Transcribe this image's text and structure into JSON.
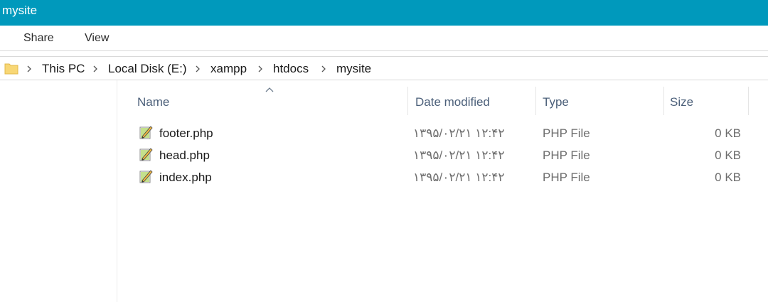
{
  "window": {
    "title": "mysite"
  },
  "ribbon": {
    "tabs": [
      "Share",
      "View"
    ]
  },
  "address": {
    "crumbs": [
      "This PC",
      "Local Disk (E:)",
      "xampp",
      "htdocs",
      "mysite"
    ]
  },
  "columns": {
    "name": "Name",
    "date": "Date modified",
    "type": "Type",
    "size": "Size"
  },
  "files": [
    {
      "name": "footer.php",
      "date": "۱۳۹۵/۰۲/۲۱ ۱۲:۴۲",
      "type": "PHP File",
      "size": "0 KB",
      "icon": "php-file-icon"
    },
    {
      "name": "head.php",
      "date": "۱۳۹۵/۰۲/۲۱ ۱۲:۴۲",
      "type": "PHP File",
      "size": "0 KB",
      "icon": "php-file-icon"
    },
    {
      "name": "index.php",
      "date": "۱۳۹۵/۰۲/۲۱ ۱۲:۴۲",
      "type": "PHP File",
      "size": "0 KB",
      "icon": "php-file-icon"
    }
  ],
  "colors": {
    "titlebar": "#0099bc",
    "header_text": "#4c607a"
  }
}
